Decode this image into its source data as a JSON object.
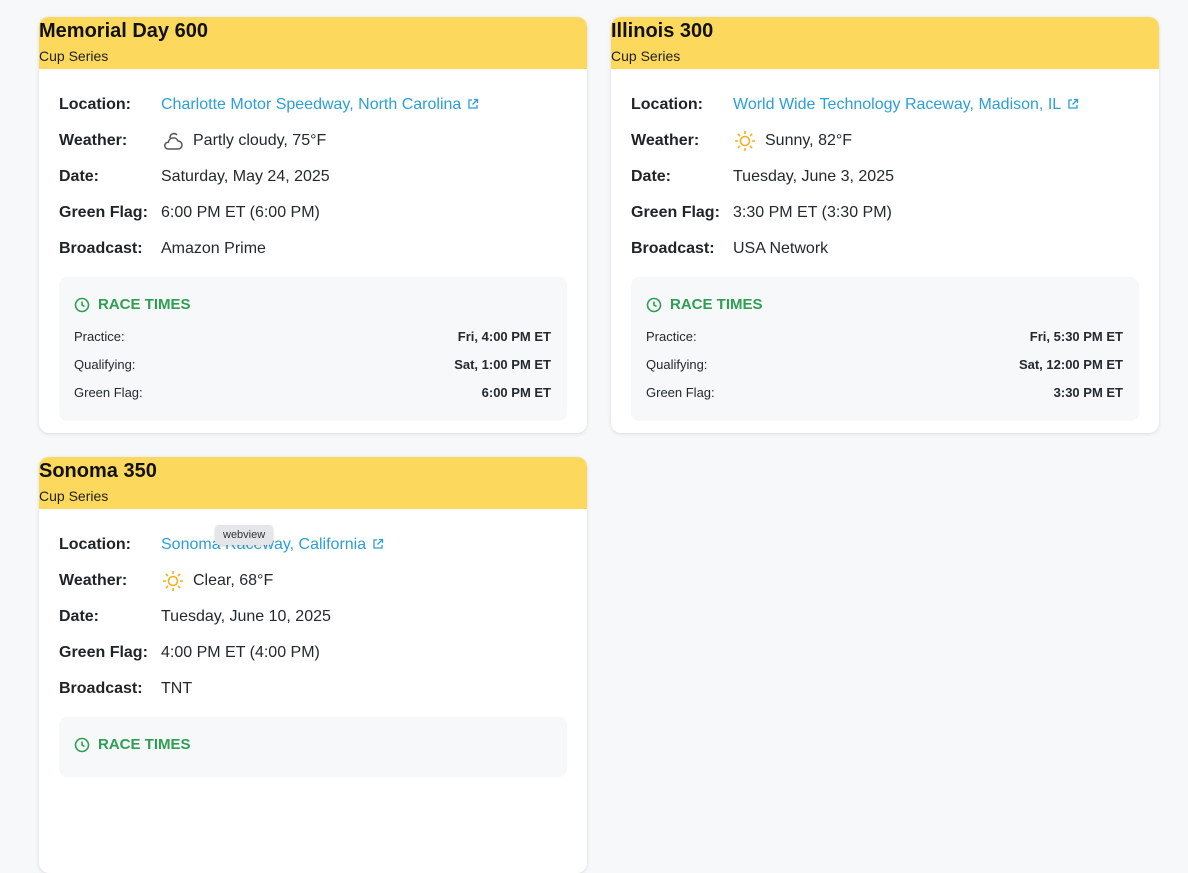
{
  "races": [
    {
      "title": "Memorial Day 600",
      "series": "Cup Series",
      "labels": {
        "location": "Location:",
        "weather": "Weather:",
        "date": "Date:",
        "green_flag": "Green Flag:",
        "broadcast": "Broadcast:"
      },
      "location": "Charlotte Motor Speedway, North Carolina",
      "weather_icon": "partly-cloudy-icon",
      "weather": "Partly cloudy, 75°F",
      "date": "Saturday, May 24, 2025",
      "green_flag": "6:00 PM ET (6:00 PM)",
      "broadcast": "Amazon Prime",
      "race_times": {
        "title": "RACE TIMES",
        "rows": [
          {
            "label": "Practice:",
            "value": "Fri, 4:00 PM ET"
          },
          {
            "label": "Qualifying:",
            "value": "Sat, 1:00 PM ET"
          },
          {
            "label": "Green Flag:",
            "value": "6:00 PM ET"
          }
        ]
      }
    },
    {
      "title": "Illinois 300",
      "series": "Cup Series",
      "labels": {
        "location": "Location:",
        "weather": "Weather:",
        "date": "Date:",
        "green_flag": "Green Flag:",
        "broadcast": "Broadcast:"
      },
      "location": "World Wide Technology Raceway, Madison, IL",
      "weather_icon": "sun-icon",
      "weather": "Sunny, 82°F",
      "date": "Tuesday, June 3, 2025",
      "green_flag": "3:30 PM ET (3:30 PM)",
      "broadcast": "USA Network",
      "race_times": {
        "title": "RACE TIMES",
        "rows": [
          {
            "label": "Practice:",
            "value": "Fri, 5:30 PM ET"
          },
          {
            "label": "Qualifying:",
            "value": "Sat, 12:00 PM ET"
          },
          {
            "label": "Green Flag:",
            "value": "3:30 PM ET"
          }
        ]
      }
    },
    {
      "title": "Sonoma 350",
      "series": "Cup Series",
      "labels": {
        "location": "Location:",
        "weather": "Weather:",
        "date": "Date:",
        "green_flag": "Green Flag:",
        "broadcast": "Broadcast:"
      },
      "location": "Sonoma Raceway, California",
      "weather_icon": "sun-icon",
      "weather": "Clear, 68°F",
      "date": "Tuesday, June 10, 2025",
      "green_flag": "4:00 PM ET (4:00 PM)",
      "broadcast": "TNT",
      "race_times": {
        "title": "RACE TIMES",
        "rows": []
      }
    }
  ],
  "tooltip": "webview",
  "colors": {
    "header": "#fcd95d",
    "link": "#2b9fd6",
    "race_times_accent": "#2f9e52",
    "sun": "#f2b21b"
  }
}
